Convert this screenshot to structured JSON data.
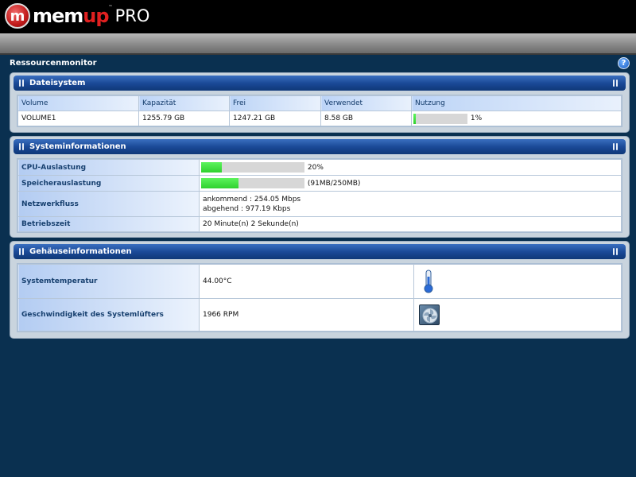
{
  "brand": {
    "badge": "m",
    "name_part1": "mem",
    "name_part2": "up",
    "tm": "™",
    "suffix": "PRO"
  },
  "page": {
    "title": "Ressourcenmonitor",
    "help_label": "?"
  },
  "filesystem": {
    "title": "Dateisystem",
    "columns": [
      "Volume",
      "Kapazität",
      "Frei",
      "Verwendet",
      "Nutzung"
    ],
    "rows": [
      {
        "volume": "VOLUME1",
        "capacity": "1255.79 GB",
        "free": "1247.21 GB",
        "used": "8.58 GB",
        "usage_text": "1%",
        "usage_percent": 1
      }
    ]
  },
  "system": {
    "title": "Systeminformationen",
    "cpu": {
      "label": "CPU-Auslastung",
      "text": "20%",
      "percent": 20
    },
    "memory": {
      "label": "Speicherauslastung",
      "text": "(91MB/250MB)",
      "percent": 36.4
    },
    "network": {
      "label": "Netzwerkfluss",
      "incoming": "ankommend : 254.05 Mbps",
      "outgoing": "abgehend : 977.19 Kbps"
    },
    "uptime": {
      "label": "Betriebszeit",
      "value": "20 Minute(n) 2 Sekunde(n)"
    }
  },
  "enclosure": {
    "title": "Gehäuseinformationen",
    "temperature": {
      "label": "Systemtemperatur",
      "value": "44.00°C",
      "icon": "thermometer-icon"
    },
    "fan": {
      "label": "Geschwindigkeit des Systemlüfters",
      "value": "1966 RPM",
      "icon": "fan-icon"
    }
  },
  "colors": {
    "header_blue": "#1b4a98",
    "bar_green": "#3ddc3d",
    "background": "#0a3050"
  }
}
